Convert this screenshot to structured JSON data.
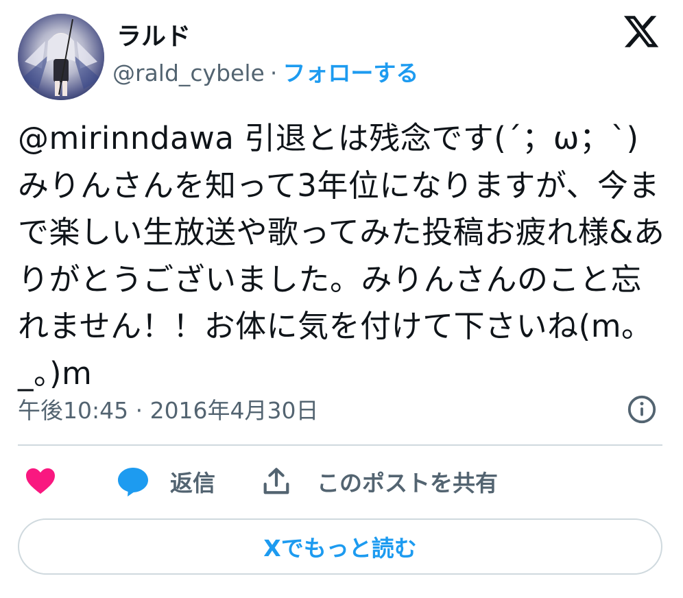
{
  "author": {
    "display_name": "ラルド",
    "handle": "@rald_cybele",
    "separator": "·",
    "follow_label": "フォローする"
  },
  "tweet": {
    "text": "@mirinndawa 引退とは残念です(´；ω；`)みりんさんを知って3年位になりますが、今まで楽しい生放送や歌ってみた投稿お疲れ様&ありがとうございました。みりんさんのこと忘れません！！お体に気を付けて下さいね(m。_。)m",
    "timestamp": "午後10:45 · 2016年4月30日"
  },
  "actions": {
    "reply_label": "返信",
    "share_label": "このポストを共有"
  },
  "read_more_label": "Xでもっと読む",
  "colors": {
    "accent": "#1d9bf0",
    "like": "#f91880",
    "muted": "#536471",
    "border": "#cfd9de",
    "text": "#0f1419"
  },
  "icons": [
    "x-logo-icon",
    "info-icon",
    "heart-icon",
    "reply-bubble-icon",
    "share-upload-icon"
  ]
}
